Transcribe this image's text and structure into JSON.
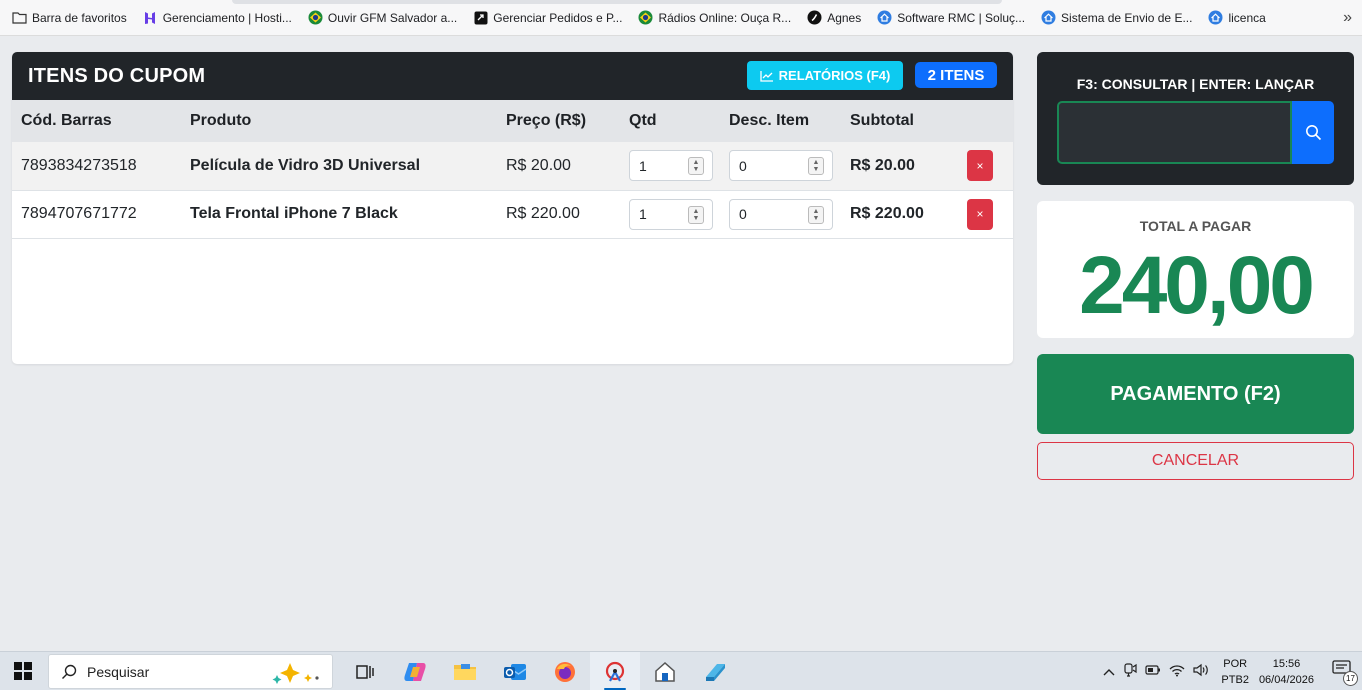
{
  "bookmarks": {
    "items": [
      {
        "label": "Barra de favoritos",
        "icon": "folder-icon"
      },
      {
        "label": "Gerenciamento | Hosti...",
        "icon": "hostinger-icon"
      },
      {
        "label": "Ouvir GFM Salvador a...",
        "icon": "brazil-flag-icon"
      },
      {
        "label": "Gerenciar Pedidos e P...",
        "icon": "box-arrow-icon"
      },
      {
        "label": "Rádios Online: Ouça R...",
        "icon": "brazil-flag-icon"
      },
      {
        "label": "Agnes",
        "icon": "agnes-icon"
      },
      {
        "label": "Software RMC | Soluç...",
        "icon": "home-icon"
      },
      {
        "label": "Sistema de Envio de E...",
        "icon": "home-icon"
      },
      {
        "label": "licenca",
        "icon": "home-icon"
      }
    ],
    "more": "»"
  },
  "cupom": {
    "title": "ITENS DO CUPOM",
    "reports_label": "RELATÓRIOS (F4)",
    "items_badge": "2 ITENS",
    "columns": [
      "Cód. Barras",
      "Produto",
      "Preço (R$)",
      "Qtd",
      "Desc. Item",
      "Subtotal",
      ""
    ],
    "rows": [
      {
        "barcode": "7893834273518",
        "product": "Película de Vidro 3D Universal",
        "price": "R$ 20.00",
        "qty": "1",
        "discount": "0",
        "subtotal": "R$ 20.00",
        "remove": "×"
      },
      {
        "barcode": "7894707671772",
        "product": "Tela Frontal iPhone 7 Black",
        "price": "R$ 220.00",
        "qty": "1",
        "discount": "0",
        "subtotal": "R$ 220.00",
        "remove": "×"
      }
    ]
  },
  "scan": {
    "label": "F3: CONSULTAR | ENTER: LANÇAR",
    "value": ""
  },
  "total": {
    "label": "TOTAL A PAGAR",
    "value": "240,00"
  },
  "actions": {
    "pay_label": "PAGAMENTO (F2)",
    "cancel_label": "CANCELAR"
  },
  "taskbar": {
    "search_placeholder": "Pesquisar",
    "lang_line1": "POR",
    "lang_line2": "PTB2",
    "time": "15:56",
    "date": "06/04/2026",
    "notifications": "17"
  },
  "colors": {
    "dark": "#212529",
    "success": "#198754",
    "primary": "#0d6efd",
    "info": "#0dcaf0",
    "danger": "#dc3545"
  }
}
